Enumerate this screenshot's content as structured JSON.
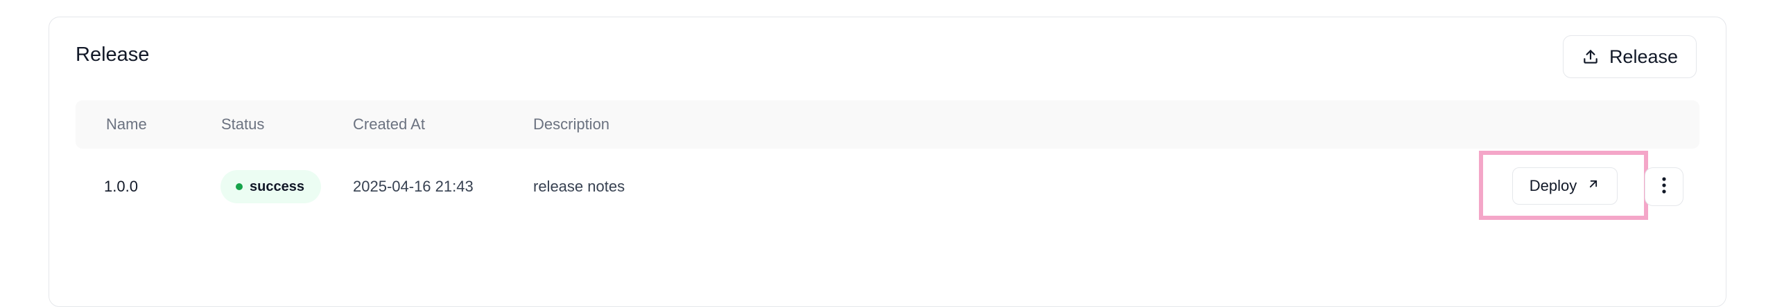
{
  "card": {
    "title": "Release",
    "release_button_label": "Release",
    "release_icon": "upload-icon"
  },
  "table": {
    "columns": [
      "Name",
      "Status",
      "Created At",
      "Description"
    ],
    "rows": [
      {
        "name": "1.0.0",
        "status": "success",
        "created_at": "2025-04-16 21:43",
        "description": "release notes",
        "deploy_label": "Deploy",
        "deploy_icon": "arrow-up-right-icon",
        "more_icon": "more-vertical-icon"
      }
    ]
  },
  "colors": {
    "status_success_dot": "#16a34a",
    "status_success_bg": "#ecfdf3",
    "highlight": "#f4a6c8",
    "header_bg": "#f9f9f9"
  }
}
